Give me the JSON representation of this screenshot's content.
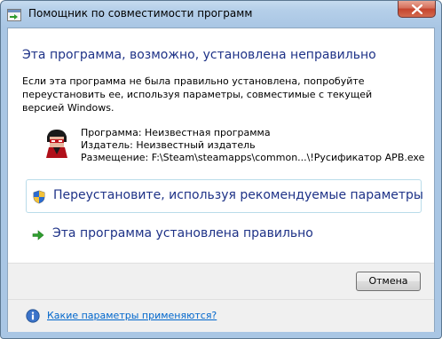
{
  "window": {
    "title": "Помощник по совместимости программ",
    "close_icon": "close-icon",
    "app_icon": "compatibility-assistant-icon"
  },
  "content": {
    "heading": "Эта программа, возможно, установлена неправильно",
    "description": "Если эта программа не была правильно установлена, попробуйте переустановить ее, используя параметры, совместимые с текущей версией Windows.",
    "program": {
      "icon": "program-icon",
      "name_line": "Программа: Неизвестная программа",
      "publisher_line": "Издатель: Неизвестный издатель",
      "location_line": "Размещение: F:\\Steam\\steamapps\\common...\\!Русификатор APB.exe"
    }
  },
  "actions": {
    "reinstall": {
      "label": "Переустановите, используя рекомендуемые параметры",
      "icon": "uac-shield-icon"
    },
    "installed_correctly": {
      "label": "Эта программа установлена правильно",
      "icon": "green-arrow-icon"
    }
  },
  "footer": {
    "cancel_label": "Отмена",
    "help_link": "Какие параметры применяются?",
    "help_icon": "info-icon"
  },
  "colors": {
    "heading": "#1e3287",
    "link": "#0066cc",
    "frame": "#a9c6e4",
    "close_button": "#c5442d"
  }
}
